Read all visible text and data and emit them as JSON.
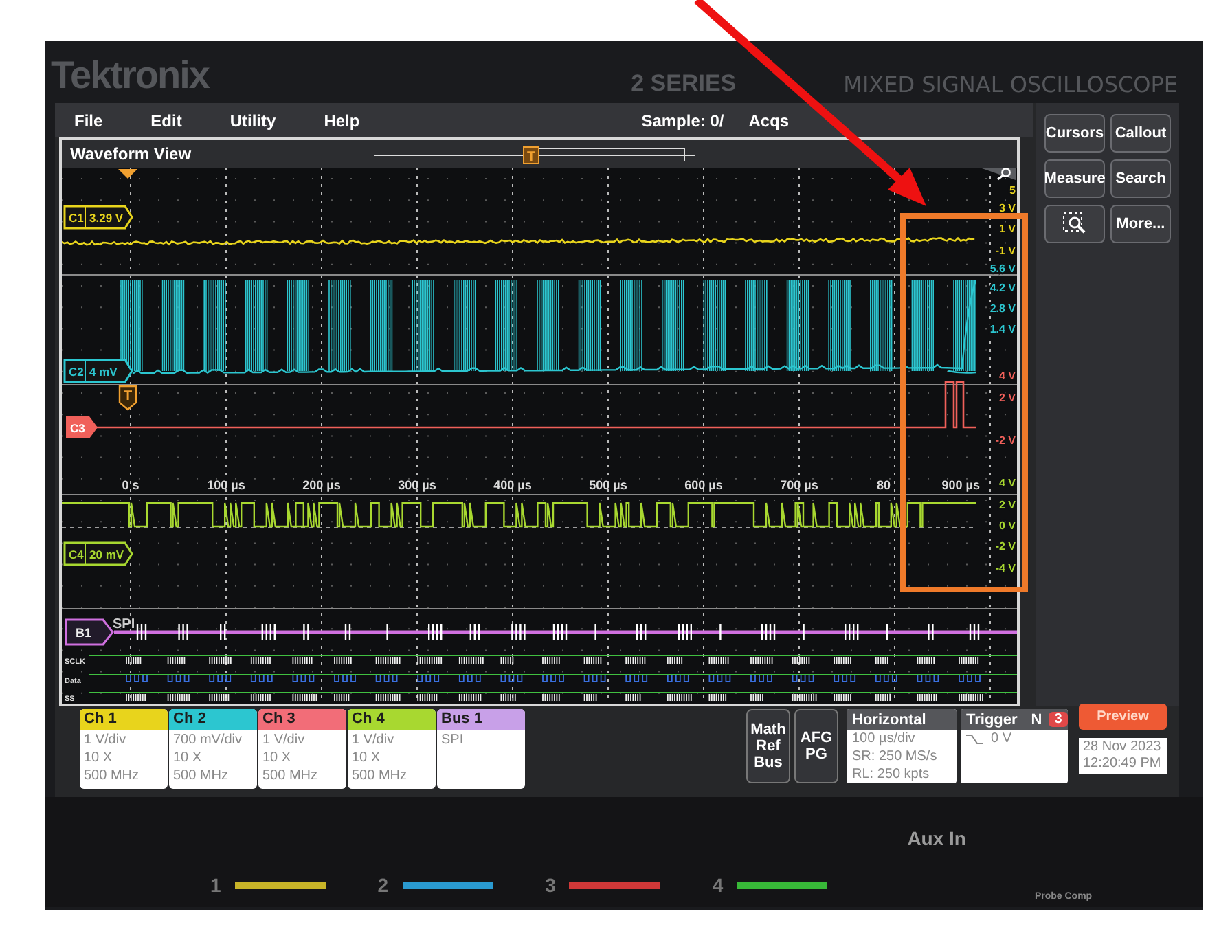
{
  "device": {
    "brand": "Tektronix",
    "series": "2 SERIES",
    "model": "MIXED SIGNAL OSCILLOSCOPE"
  },
  "menu": [
    {
      "label": "File"
    },
    {
      "label": "Edit"
    },
    {
      "label": "Utility"
    },
    {
      "label": "Help"
    }
  ],
  "acquisition": {
    "status_start": "Sample: 0/",
    "status_end": "Acqs"
  },
  "waveform_view": {
    "title": "Waveform View",
    "overview_marker": "T",
    "trigger_marker": "T",
    "time_ticks": [
      "0 s",
      "100 µs",
      "200 µs",
      "300 µs",
      "400 µs",
      "500 µs",
      "600 µs",
      "700 µs",
      "80",
      "900 µs"
    ],
    "channels": [
      {
        "kind": "steady",
        "label": "C1",
        "reading": "3.29 V",
        "color": "#e8d41c",
        "scale": [
          "5",
          "3 V",
          "1 V",
          "-1 V"
        ]
      },
      {
        "kind": "burst",
        "label": "C2",
        "reading": "4 mV",
        "color": "#2cc6d0",
        "scale": [
          "5.6 V",
          "4.2 V",
          "2.8 V",
          "1.4 V"
        ]
      },
      {
        "kind": "pulse",
        "label": "C3",
        "color": "#f0605a",
        "scale": [
          "4 V",
          "2 V",
          "-2 V"
        ]
      },
      {
        "kind": "square",
        "label": "C4",
        "reading": "20 mV",
        "color": "#a8d830",
        "scale": [
          "4 V",
          "2 V",
          "0 V",
          "-2 V",
          "-4 V"
        ]
      },
      {
        "kind": "bus",
        "label": "B1",
        "reading": "SPI",
        "color": "#d070e0",
        "signals": [
          "SCLK",
          "Data",
          "SS"
        ]
      }
    ]
  },
  "side_buttons": [
    {
      "kind": "text",
      "label": "Cursors"
    },
    {
      "kind": "text",
      "label": "Callout"
    },
    {
      "kind": "text",
      "label": "Measure"
    },
    {
      "kind": "text",
      "label": "Search"
    },
    {
      "kind": "icon"
    },
    {
      "kind": "text",
      "label": "More..."
    }
  ],
  "badges": [
    {
      "title": "Ch 1",
      "color": "#e8d41c",
      "lines": [
        "1 V/div",
        "10 X",
        "500 MHz"
      ]
    },
    {
      "title": "Ch 2",
      "color": "#2cc6d0",
      "lines": [
        "700 mV/div",
        "10 X",
        "500 MHz"
      ]
    },
    {
      "title": "Ch 3",
      "color": "#f26d78",
      "lines": [
        "1 V/div",
        "10 X",
        "500 MHz"
      ]
    },
    {
      "title": "Ch 4",
      "color": "#a8d830",
      "lines": [
        "1 V/div",
        "10 X",
        "500 MHz"
      ]
    },
    {
      "title": "Bus 1",
      "color": "#c8a0e8",
      "lines": [
        "SPI"
      ]
    }
  ],
  "add_buttons": [
    {
      "lines": [
        "Math",
        "Ref",
        "Bus"
      ]
    },
    {
      "lines": [
        "AFG",
        "PG"
      ]
    }
  ],
  "horizontal": {
    "title": "Horizontal",
    "lines": [
      "100 µs/div",
      "SR: 250 MS/s",
      "RL: 250 kpts"
    ]
  },
  "trigger": {
    "title": "Trigger",
    "mode": "N",
    "count": "3",
    "level": "0 V"
  },
  "preview": {
    "label": "Preview"
  },
  "datetime": [
    "28 Nov 2023",
    "12:20:49 PM"
  ],
  "front_panel": {
    "channel_keys": [
      {
        "label": "1",
        "color": "#c8b428"
      },
      {
        "label": "2",
        "color": "#2a9ad0"
      },
      {
        "label": "3",
        "color": "#d03838"
      },
      {
        "label": "4",
        "color": "#38b838"
      }
    ],
    "aux_in": "Aux In",
    "probe_comp": "Probe Comp"
  }
}
